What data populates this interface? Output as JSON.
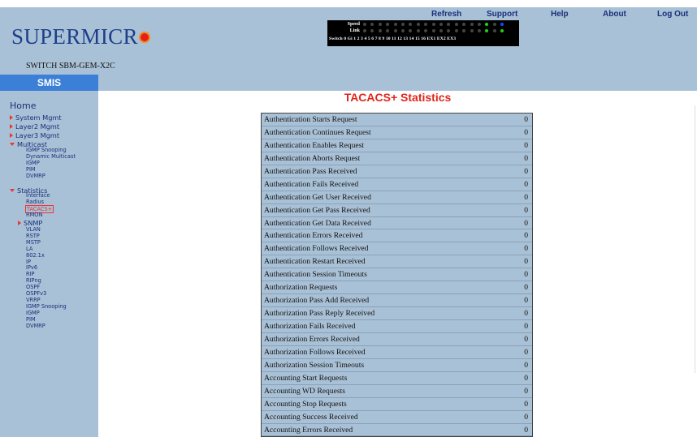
{
  "nav": {
    "refresh": "Refresh",
    "support": "Support",
    "help": "Help",
    "about": "About",
    "logout": "Log Out"
  },
  "brand": {
    "logo_text": "SUPERMICR",
    "model": "SWITCH SBM-GEM-X2C",
    "app_name": "SMIS"
  },
  "ports": {
    "speed_label": "Speed",
    "link_label": "Link",
    "switch_label": "Switch 0 Gi",
    "numbers": "1  2  3  4  5  6  7  8  9  10 11 12 13 14 15 16 EX1 EX2 EX3"
  },
  "sidebar": {
    "home": "Home",
    "system_mgmt": "System Mgmt",
    "layer2_mgmt": "Layer2 Mgmt",
    "layer3_mgmt": "Layer3 Mgmt",
    "multicast": "Multicast",
    "multicast_items": [
      "IGMP Snooping",
      "Dynamic Multicast",
      "IGMP",
      "PIM",
      "DVMRP"
    ],
    "statistics": "Statistics",
    "statistics_items_a": [
      "Interface",
      "Radius",
      "TACACS+",
      "RMON"
    ],
    "snmp": "SNMP",
    "statistics_items_b": [
      "VLAN",
      "RSTP",
      "MSTP",
      "LA",
      "802.1x",
      "IP",
      "IPv6",
      "RIP",
      "RIPng",
      "OSPF",
      "OSPFv3",
      "VRRP",
      "IGMP Snooping",
      "IGMP",
      "PIM",
      "DVMRP"
    ]
  },
  "page": {
    "title": "TACACS+ Statistics"
  },
  "stats": [
    {
      "label": "Authentication Starts Request",
      "value": "0"
    },
    {
      "label": "Authentication Continues Request",
      "value": "0"
    },
    {
      "label": "Authentication Enables Request",
      "value": "0"
    },
    {
      "label": "Authentication Aborts Request",
      "value": "0"
    },
    {
      "label": "Authentication Pass Received",
      "value": "0"
    },
    {
      "label": "Authentication Fails Received",
      "value": "0"
    },
    {
      "label": "Authentication Get User Received",
      "value": "0"
    },
    {
      "label": "Authentication Get Pass Received",
      "value": "0"
    },
    {
      "label": "Authentication Get Data Received",
      "value": "0"
    },
    {
      "label": "Authentication Errors Received",
      "value": "0"
    },
    {
      "label": "Authentication Follows Received",
      "value": "0"
    },
    {
      "label": "Authentication Restart Received",
      "value": "0"
    },
    {
      "label": "Authentication Session Timeouts",
      "value": "0"
    },
    {
      "label": "Authorization Requests",
      "value": "0"
    },
    {
      "label": "Authorization Pass Add Received",
      "value": "0"
    },
    {
      "label": "Authorization Pass Reply Received",
      "value": "0"
    },
    {
      "label": "Authorization Fails Received",
      "value": "0"
    },
    {
      "label": "Authorization Errors Received",
      "value": "0"
    },
    {
      "label": "Authorization Follows Received",
      "value": "0"
    },
    {
      "label": "Authorization Session Timeouts",
      "value": "0"
    },
    {
      "label": "Accounting Start Requests",
      "value": "0"
    },
    {
      "label": "Accounting WD Requests",
      "value": "0"
    },
    {
      "label": "Accounting Stop Requests",
      "value": "0"
    },
    {
      "label": "Accounting Success Received",
      "value": "0"
    },
    {
      "label": "Accounting Errors Received",
      "value": "0"
    }
  ],
  "colors": {
    "header_bg": "#a9c1d6",
    "smis_bar": "#3b7fd6",
    "title_red": "#e0261c",
    "link_blue": "#1a2f7a"
  }
}
